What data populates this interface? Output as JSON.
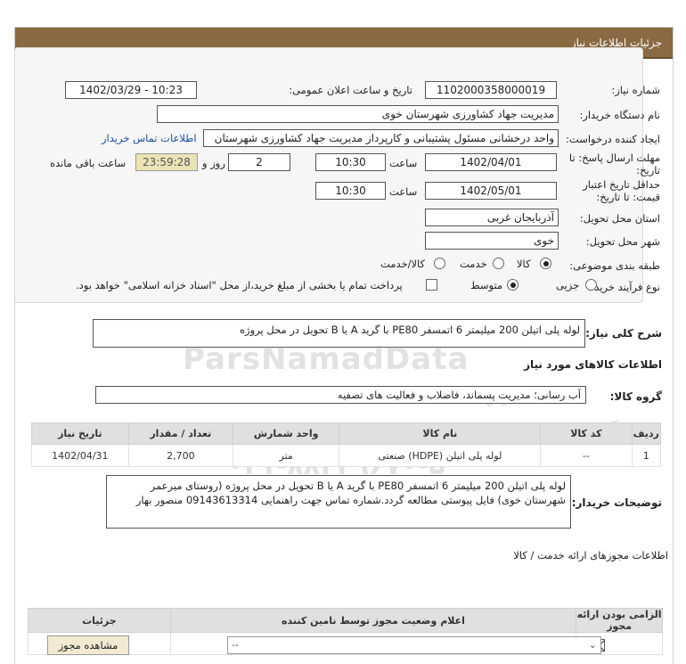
{
  "header": {
    "title": "جزئیات اطلاعات نیاز"
  },
  "form": {
    "need_number_label": "شماره نیاز:",
    "need_number": "1102000358000019",
    "announce_label": "تاریخ و ساعت اعلان عمومی:",
    "announce_value": "1402/03/29 - 10:23",
    "buyer_label": "نام دستگاه خریدار:",
    "buyer_value": "مدیریت جهاد کشاورزی شهرستان خوی",
    "requester_label": "ایجاد کننده درخواست:",
    "requester_value": "واحد درخشانی مسئول پشتیبانی و کارپرداز مدیریت جهاد کشاورزی شهرستان",
    "contact_link": "اطلاعات تماس خریدار",
    "deadline_label_1": "مهلت ارسال پاسخ: تا",
    "deadline_label_2": "تاریخ:",
    "deadline_date": "1402/04/01",
    "time_label": "ساعت",
    "deadline_time": "10:30",
    "days_value": "2",
    "days_label": "روز و",
    "remaining_value": "23:59:28",
    "remaining_label": "ساعت باقی مانده",
    "validity_label_1": "حداقل تاریخ اعتبار",
    "validity_label_2": "قیمت: تا تاریخ:",
    "validity_date": "1402/05/01",
    "validity_time": "10:30",
    "province_label": "استان محل تحویل:",
    "province_value": "آذربایجان غربی",
    "city_label": "شهر محل تحویل:",
    "city_value": "خوی",
    "category_label": "طبقه بندی موضوعی:",
    "category_options": [
      "کالا",
      "خدمت",
      "کالا/خدمت"
    ],
    "category_selected": "کالا",
    "process_label": "نوع فرآیند خرید :",
    "process_options": [
      "جزیی",
      "متوسط"
    ],
    "process_selected": "متوسط",
    "payment_note": "پرداخت تمام یا بخشی از مبلغ خرید،از محل \"اسناد خزانه اسلامی\" خواهد بود."
  },
  "summary": {
    "label": "شرح کلی نیاز:",
    "value": "لوله پلی اتیلن 200 میلیمتر 6 اتمسفر PE80 با گرید A یا B تحویل در محل پروژه"
  },
  "goods": {
    "section_title": "اطلاعات کالاهای مورد نیاز",
    "group_label": "گروه کالا:",
    "group_value": "آب رسانی؛ مدیریت پسماند، فاضلاب و فعالیت های تصفیه",
    "columns": [
      "ردیف",
      "کد کالا",
      "نام کالا",
      "واحد شمارش",
      "تعداد / مقدار",
      "تاریخ نیاز"
    ],
    "rows": [
      {
        "row": "1",
        "code": "--",
        "name": "لوله پلی اتیلن (HDPE) صنعتی",
        "unit": "متر",
        "qty": "2,700",
        "date": "1402/04/31"
      }
    ]
  },
  "buyer_notes": {
    "label": "توضیحات خریدار:",
    "value": "لوله پلی اتیلن 200 میلیمتر 6 اتمسفر PE80 با گرید A یا B تحویل در محل پروژه (روستای میرعمر شهرستان خوی) فایل پیوستی مطالعه گردد.شماره تماس جهت راهنمایی 09143613314 منصور بهار"
  },
  "permits": {
    "section_title": "اطلاعات مجوزهای ارائه خدمت / کالا",
    "columns": [
      "الزامی بودن ارائه مجوز",
      "اعلام وضعیت مجوز توسط نامین کننده",
      "جزئیات"
    ],
    "select_value": "--",
    "view_button": "مشاهده مجوز"
  },
  "watermark": {
    "brand": "ParsNamadData",
    "line1": "پایگاه اطلاع رسانی مناقصات و مزایده های ایران",
    "line2": "پارس نماد داده",
    "phone": "۰۲۱-۸۸۳۴۹۶۷۰-۵"
  }
}
